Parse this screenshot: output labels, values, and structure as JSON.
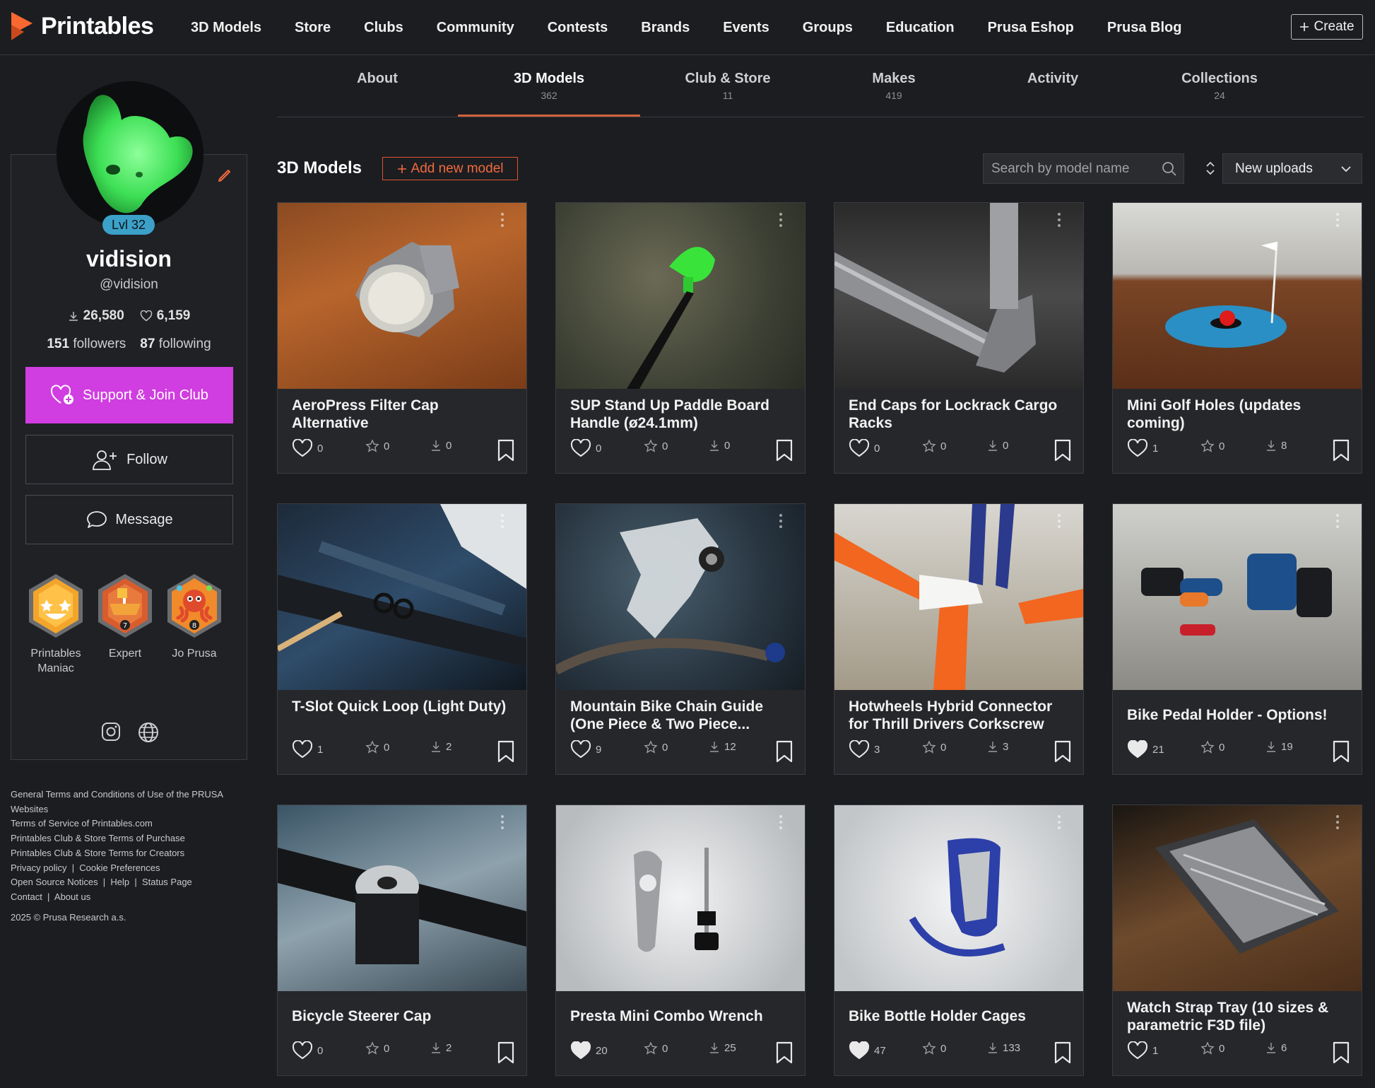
{
  "brand": {
    "name": "Printables",
    "accent": "#fa6831"
  },
  "nav": {
    "items": [
      "3D Models",
      "Store",
      "Clubs",
      "Community",
      "Contests",
      "Brands",
      "Events",
      "Groups",
      "Education",
      "Prusa Eshop",
      "Prusa Blog"
    ],
    "create_label": "Create"
  },
  "profile": {
    "level": "Lvl 32",
    "name": "vidision",
    "handle": "@vidision",
    "downloads": "26,580",
    "likes": "6,159",
    "followers_count": "151",
    "followers_label": "followers",
    "following_count": "87",
    "following_label": "following",
    "support_label": "Support & Join Club",
    "follow_label": "Follow",
    "message_label": "Message",
    "badges": [
      {
        "label": "Printables Maniac",
        "icon": "smiley-badge-icon"
      },
      {
        "label": "Expert",
        "icon": "boat-badge-icon"
      },
      {
        "label": "Jo Prusa",
        "icon": "octopus-badge-icon"
      }
    ]
  },
  "footer": {
    "links": [
      "General Terms and Conditions of Use of the PRUSA Websites",
      "Terms of Service of Printables.com",
      "Printables Club & Store Terms of Purchase",
      "Printables Club & Store Terms for Creators",
      "Privacy policy  |  Cookie Preferences",
      "Open Source Notices  |  Help  |  Status Page",
      "Contact  |  About us"
    ],
    "copyright": "2025 © Prusa Research a.s."
  },
  "tabs": [
    {
      "label": "About",
      "count": ""
    },
    {
      "label": "3D Models",
      "count": "362"
    },
    {
      "label": "Club & Store",
      "count": "11"
    },
    {
      "label": "Makes",
      "count": "419"
    },
    {
      "label": "Activity",
      "count": ""
    },
    {
      "label": "Collections",
      "count": "24"
    }
  ],
  "models_section": {
    "title": "3D Models",
    "add_label": "Add new model",
    "search_placeholder": "Search by model name",
    "sort_value": "New uploads"
  },
  "models": [
    {
      "title": "AeroPress Filter Cap Alternative",
      "likes": "0",
      "stars": "0",
      "downloads": "0",
      "liked": false,
      "image": "aeropress-filter-cap-photo"
    },
    {
      "title": "SUP Stand Up Paddle Board Handle (ø24.1mm)",
      "likes": "0",
      "stars": "0",
      "downloads": "0",
      "liked": false,
      "image": "paddle-handle-photo"
    },
    {
      "title": "End Caps for Lockrack Cargo Racks",
      "likes": "0",
      "stars": "0",
      "downloads": "0",
      "liked": false,
      "image": "cargo-rack-end-cap-photo"
    },
    {
      "title": "Mini Golf Holes (updates coming)",
      "likes": "1",
      "stars": "0",
      "downloads": "8",
      "liked": false,
      "image": "mini-golf-hole-photo"
    },
    {
      "title": "T-Slot Quick Loop (Light Duty)",
      "likes": "1",
      "stars": "0",
      "downloads": "2",
      "liked": false,
      "image": "t-slot-loop-photo"
    },
    {
      "title": "Mountain Bike Chain Guide (One Piece & Two Piece...",
      "likes": "9",
      "stars": "0",
      "downloads": "12",
      "liked": false,
      "image": "chain-guide-photo"
    },
    {
      "title": "Hotwheels Hybrid Connector for Thrill Drivers Corkscrew",
      "likes": "3",
      "stars": "0",
      "downloads": "3",
      "liked": false,
      "image": "hotwheels-connector-photo"
    },
    {
      "title": "Bike Pedal Holder - Options!",
      "likes": "21",
      "stars": "0",
      "downloads": "19",
      "liked": true,
      "image": "pedal-holder-photo"
    },
    {
      "title": "Bicycle Steerer Cap",
      "likes": "0",
      "stars": "0",
      "downloads": "2",
      "liked": false,
      "image": "steerer-cap-photo"
    },
    {
      "title": "Presta Mini Combo Wrench",
      "likes": "20",
      "stars": "0",
      "downloads": "25",
      "liked": true,
      "image": "presta-wrench-photo"
    },
    {
      "title": "Bike Bottle Holder Cages",
      "likes": "47",
      "stars": "0",
      "downloads": "133",
      "liked": true,
      "image": "bottle-cage-photo"
    },
    {
      "title": "Watch Strap Tray (10 sizes & parametric F3D file)",
      "likes": "1",
      "stars": "0",
      "downloads": "6",
      "liked": false,
      "image": "watch-strap-tray-photo"
    }
  ]
}
